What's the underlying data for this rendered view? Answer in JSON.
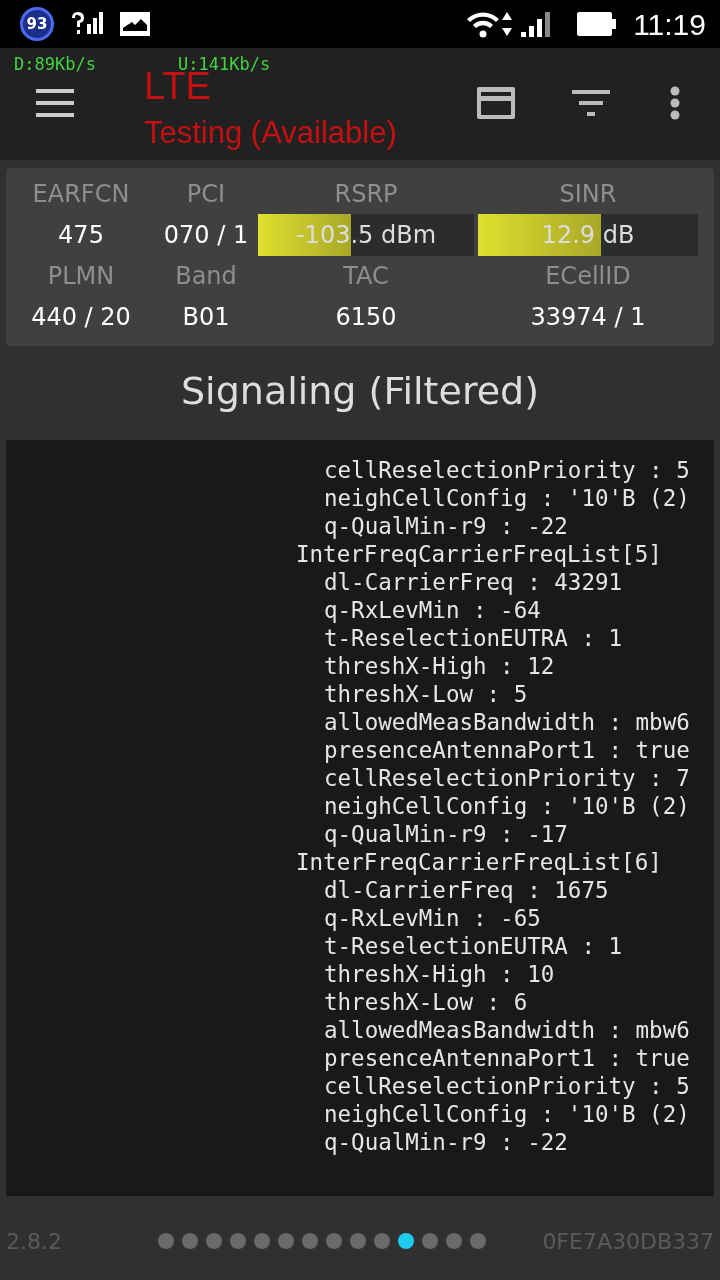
{
  "status_bar": {
    "badge": "93",
    "time": "11:19"
  },
  "speeds": {
    "download": "D:89Kb/s",
    "upload": "U:141Kb/s"
  },
  "app_bar": {
    "title": "LTE",
    "subtitle": "Testing (Available)"
  },
  "cell_info": [
    {
      "label": "EARFCN",
      "value": "475",
      "kind": "text"
    },
    {
      "label": "PCI",
      "value": "070 / 1",
      "kind": "text"
    },
    {
      "label": "RSRP",
      "value": "-103.5 dBm",
      "kind": "meter",
      "level": 0.43
    },
    {
      "label": "SINR",
      "value": "12.9 dB",
      "kind": "meter",
      "level": 0.56
    },
    {
      "label": "PLMN",
      "value": "440 / 20",
      "kind": "text"
    },
    {
      "label": "Band",
      "value": "B01",
      "kind": "text"
    },
    {
      "label": "TAC",
      "value": "6150",
      "kind": "text"
    },
    {
      "label": "ECellID",
      "value": "33974 / 1",
      "kind": "text"
    }
  ],
  "section_title": "Signaling (Filtered)",
  "detail_tree": [
    {
      "children": [
        {
          "text": "cellReselectionPriority : 5"
        },
        {
          "text": "neighCellConfig : '10'B (2)"
        },
        {
          "text": "q-QualMin-r9 : -22"
        }
      ]
    },
    {
      "text": "InterFreqCarrierFreqList[5]",
      "children": [
        {
          "text": "dl-CarrierFreq : 43291"
        },
        {
          "text": "q-RxLevMin : -64"
        },
        {
          "text": "t-ReselectionEUTRA : 1"
        },
        {
          "text": "threshX-High : 12"
        },
        {
          "text": "threshX-Low : 5"
        },
        {
          "text": "allowedMeasBandwidth : mbw6"
        },
        {
          "text": "presenceAntennaPort1 : true"
        },
        {
          "text": "cellReselectionPriority : 7"
        },
        {
          "text": "neighCellConfig : '10'B (2)"
        },
        {
          "text": "q-QualMin-r9 : -17"
        }
      ]
    },
    {
      "text": "InterFreqCarrierFreqList[6]",
      "children": [
        {
          "text": "dl-CarrierFreq : 1675"
        },
        {
          "text": "q-RxLevMin : -65"
        },
        {
          "text": "t-ReselectionEUTRA : 1"
        },
        {
          "text": "threshX-High : 10"
        },
        {
          "text": "threshX-Low : 6"
        },
        {
          "text": "allowedMeasBandwidth : mbw6"
        },
        {
          "text": "presenceAntennaPort1 : true"
        },
        {
          "text": "cellReselectionPriority : 5"
        },
        {
          "text": "neighCellConfig : '10'B (2)"
        },
        {
          "text": "q-QualMin-r9 : -22"
        }
      ]
    }
  ],
  "footer": {
    "version": "2.8.2",
    "device_id": "0FE7A30DB337",
    "pages": [
      {
        "selected": false
      },
      {
        "selected": false
      },
      {
        "selected": false
      },
      {
        "selected": false
      },
      {
        "selected": false
      },
      {
        "selected": false
      },
      {
        "selected": false
      },
      {
        "selected": false
      },
      {
        "selected": false
      },
      {
        "selected": false
      },
      {
        "selected": true
      },
      {
        "selected": false
      },
      {
        "selected": false
      },
      {
        "selected": false
      }
    ]
  }
}
